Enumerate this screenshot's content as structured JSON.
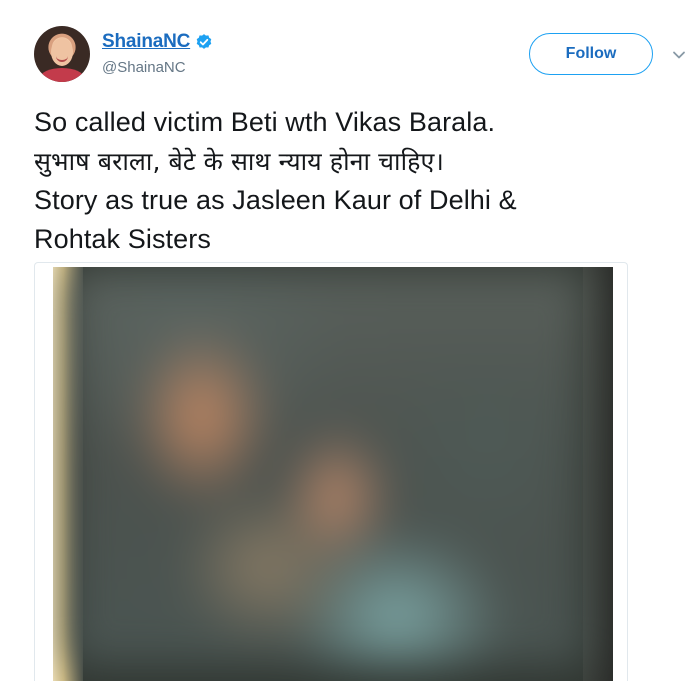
{
  "user": {
    "display_name": "ShainaNC",
    "handle": "@ShainaNC",
    "verified_icon": "verified-badge-icon"
  },
  "actions": {
    "follow_label": "Follow",
    "menu_icon": "chevron-down-icon"
  },
  "tweet": {
    "lines": [
      "So called victim Beti wth Vikas Barala.",
      "सुभाष बराला, बेटे के साथ न्याय होना चाहिए।",
      "Story as true as Jasleen Kaur of Delhi &",
      "Rohtak Sisters"
    ]
  },
  "colors": {
    "brand": "#1da1f2",
    "link": "#1b6cbf",
    "text": "#14171a",
    "secondary": "#657786"
  }
}
